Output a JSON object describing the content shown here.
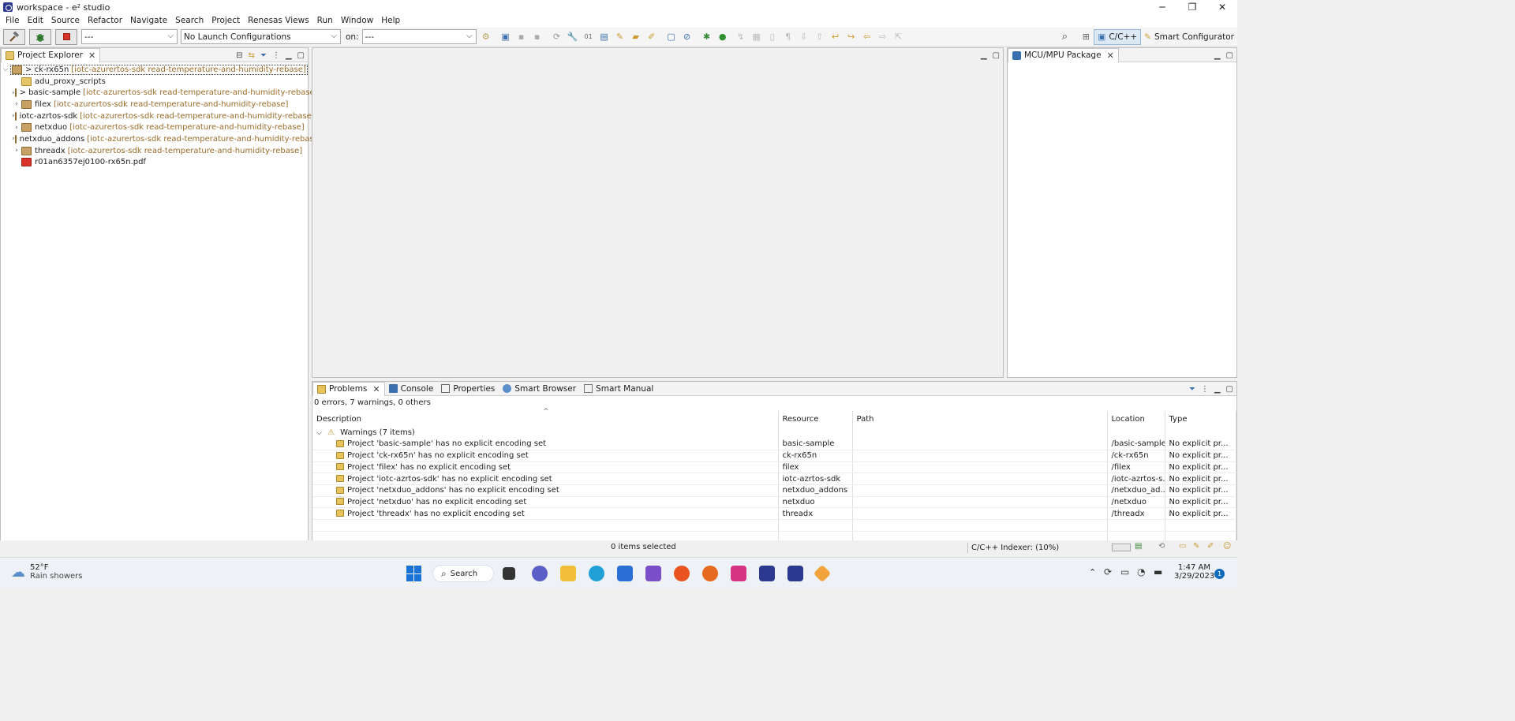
{
  "window": {
    "title": "workspace - e² studio",
    "minimize": "─",
    "maximize": "❐",
    "close": "✕"
  },
  "menu": [
    "File",
    "Edit",
    "Source",
    "Refactor",
    "Navigate",
    "Search",
    "Project",
    "Renesas Views",
    "Run",
    "Window",
    "Help"
  ],
  "toolbar": {
    "launch_mode": "---",
    "launch_config": "No Launch Configurations",
    "on_label": "on:",
    "launch_target": "---",
    "perspective_cpp": "C/C++",
    "perspective_smart": "Smart Configurator"
  },
  "project_explorer": {
    "tab_label": "Project Explorer",
    "items": [
      {
        "name": "ck-rx65n",
        "prefix": "> ",
        "deco": "[iotc-azurertos-sdk read-temperature-and-humidity-rebase]",
        "expanded": true,
        "icon": "project-icon"
      },
      {
        "name": "adu_proxy_scripts",
        "prefix": "",
        "deco": "",
        "expanded": null,
        "icon": "folder-icon"
      },
      {
        "name": "basic-sample",
        "prefix": "> ",
        "deco": "[iotc-azurertos-sdk read-temperature-and-humidity-rebase]",
        "expanded": false,
        "icon": "project-icon"
      },
      {
        "name": "filex",
        "prefix": "",
        "deco": "[iotc-azurertos-sdk read-temperature-and-humidity-rebase]",
        "expanded": false,
        "icon": "project-icon"
      },
      {
        "name": "iotc-azrtos-sdk",
        "prefix": "",
        "deco": "[iotc-azurertos-sdk read-temperature-and-humidity-rebase]",
        "expanded": false,
        "icon": "project-icon"
      },
      {
        "name": "netxduo",
        "prefix": "",
        "deco": "[iotc-azurertos-sdk read-temperature-and-humidity-rebase]",
        "expanded": false,
        "icon": "project-icon"
      },
      {
        "name": "netxduo_addons",
        "prefix": "",
        "deco": "[iotc-azurertos-sdk read-temperature-and-humidity-rebase]",
        "expanded": false,
        "icon": "project-icon"
      },
      {
        "name": "threadx",
        "prefix": "",
        "deco": "[iotc-azurertos-sdk read-temperature-and-humidity-rebase]",
        "expanded": false,
        "icon": "project-icon"
      },
      {
        "name": "r01an6357ej0100-rx65n.pdf",
        "prefix": "",
        "deco": "",
        "expanded": null,
        "icon": "pdf-icon"
      }
    ]
  },
  "mcu_panel": {
    "tab_label": "MCU/MPU Package"
  },
  "bottom_panel": {
    "tabs": [
      "Problems",
      "Console",
      "Properties",
      "Smart Browser",
      "Smart Manual"
    ],
    "summary": "0 errors, 7 warnings, 0 others",
    "columns": [
      "Description",
      "Resource",
      "Path",
      "Location",
      "Type"
    ],
    "group_label": "Warnings (7 items)",
    "rows": [
      {
        "description": "Project 'basic-sample' has no explicit encoding set",
        "resource": "basic-sample",
        "path": "",
        "location": "/basic-sample",
        "type": "No explicit pr..."
      },
      {
        "description": "Project 'ck-rx65n' has no explicit encoding set",
        "resource": "ck-rx65n",
        "path": "",
        "location": "/ck-rx65n",
        "type": "No explicit pr..."
      },
      {
        "description": "Project 'filex' has no explicit encoding set",
        "resource": "filex",
        "path": "",
        "location": "/filex",
        "type": "No explicit pr..."
      },
      {
        "description": "Project 'iotc-azrtos-sdk' has no explicit encoding set",
        "resource": "iotc-azrtos-sdk",
        "path": "",
        "location": "/iotc-azrtos-s...",
        "type": "No explicit pr..."
      },
      {
        "description": "Project 'netxduo_addons' has no explicit encoding set",
        "resource": "netxduo_addons",
        "path": "",
        "location": "/netxduo_ad...",
        "type": "No explicit pr..."
      },
      {
        "description": "Project 'netxduo' has no explicit encoding set",
        "resource": "netxduo",
        "path": "",
        "location": "/netxduo",
        "type": "No explicit pr..."
      },
      {
        "description": "Project 'threadx' has no explicit encoding set",
        "resource": "threadx",
        "path": "",
        "location": "/threadx",
        "type": "No explicit pr..."
      }
    ]
  },
  "status": {
    "selection": "0 items selected",
    "indexer": "C/C++ Indexer: (10%)"
  },
  "taskbar": {
    "weather_temp": "52°F",
    "weather_desc": "Rain showers",
    "search": "Search",
    "time": "1:47 AM",
    "date": "3/29/2023",
    "notification_count": "1"
  },
  "colors": {
    "accent": "#0f6cbd",
    "decoration": "#9a6b28",
    "warning": "#e8c35a"
  }
}
